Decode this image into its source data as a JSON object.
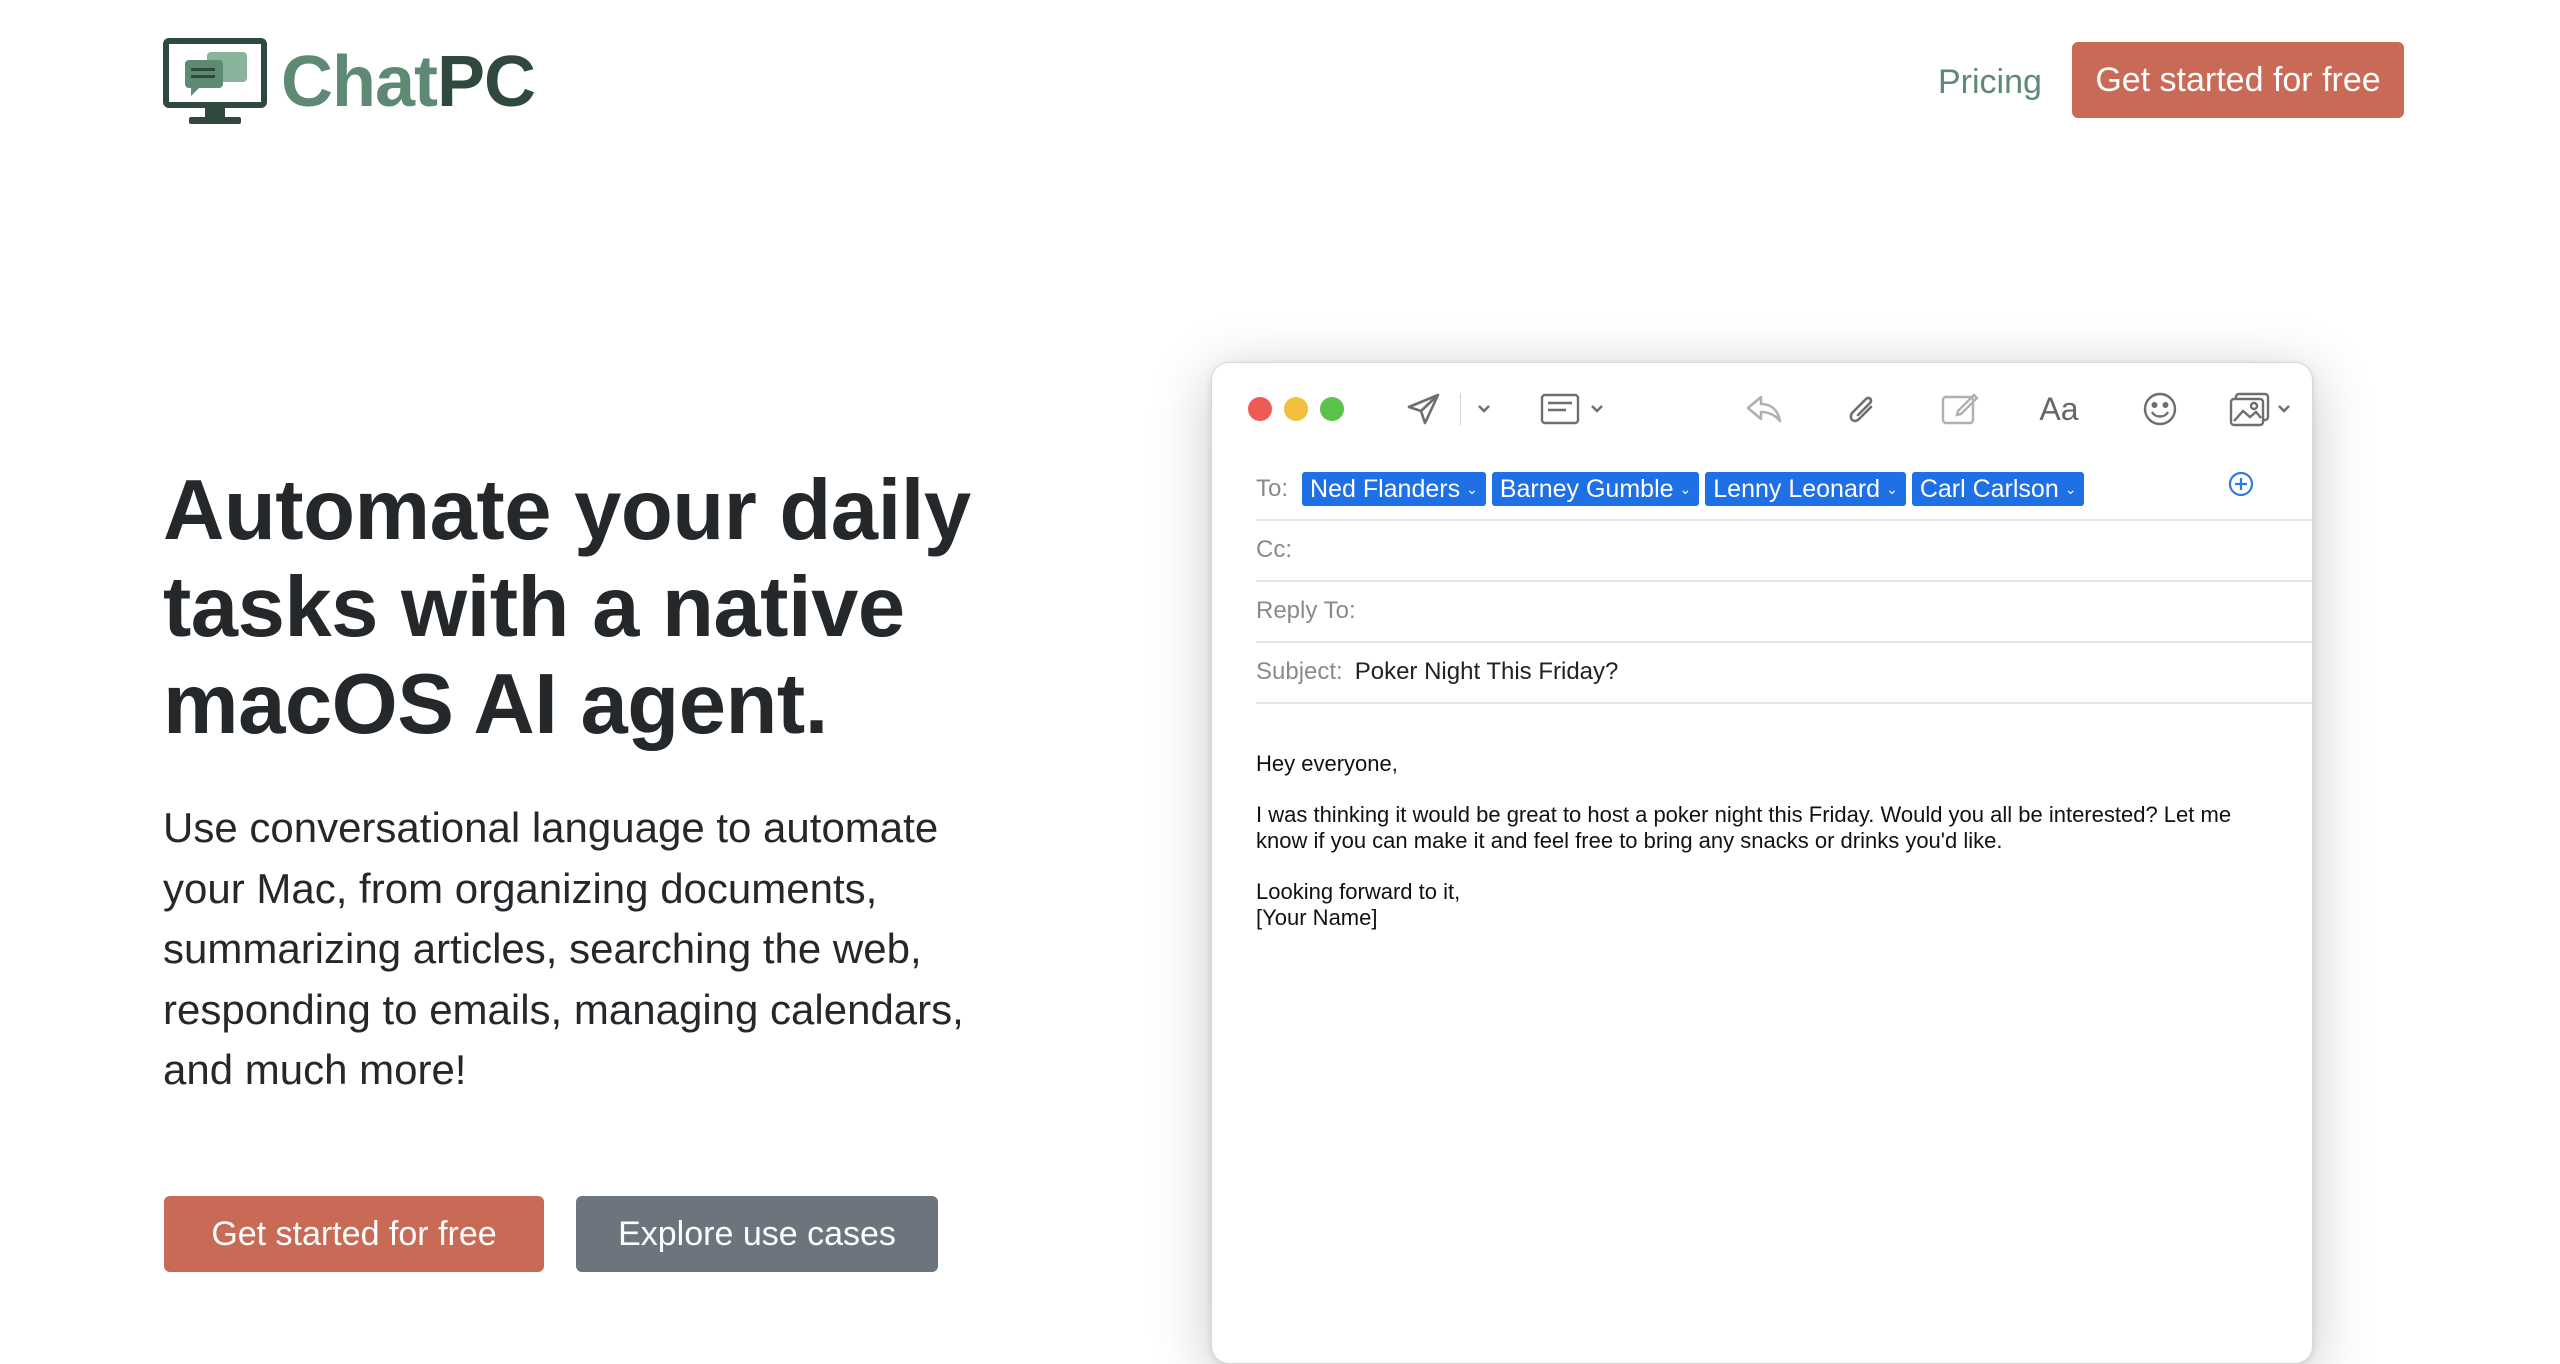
{
  "header": {
    "brand_part1": "Chat",
    "brand_part2": "PC",
    "nav_pricing": "Pricing",
    "nav_cta": "Get started for free"
  },
  "hero": {
    "title": "Automate your daily tasks with a native macOS AI agent.",
    "description": "Use conversational language to automate your Mac, from organizing documents, summarizing articles, searching the web, responding to emails, managing calendars, and much more!",
    "cta_primary": "Get started for free",
    "cta_secondary": "Explore use cases"
  },
  "mail": {
    "to_label": "To:",
    "recipients": [
      "Ned Flanders",
      "Barney Gumble",
      "Lenny Leonard",
      "Carl Carlson"
    ],
    "cc_label": "Cc:",
    "reply_to_label": "Reply To:",
    "subject_label": "Subject:",
    "subject": "Poker Night This Friday?",
    "font_button": "Aa",
    "body": {
      "greeting": "Hey everyone,",
      "paragraph": "I was thinking it would be great to host a poker night this Friday. Would you all be interested? Let me know if you can make it and feel free to bring any snacks or drinks you'd like.",
      "closing": "Looking forward to it,",
      "signature": "[Your Name]"
    },
    "toolbar_icons": [
      "send-icon",
      "chevron-down-icon",
      "header-fields-icon",
      "reply-icon",
      "attachment-icon",
      "markup-icon",
      "font-icon",
      "emoji-icon",
      "photo-browser-icon"
    ]
  },
  "colors": {
    "brand_green": "#5e8a73",
    "brand_dark_green": "#2f4a3c",
    "primary_button": "#c96a56",
    "secondary_button": "#6c757d",
    "recipient_chip": "#1f6fe5"
  }
}
